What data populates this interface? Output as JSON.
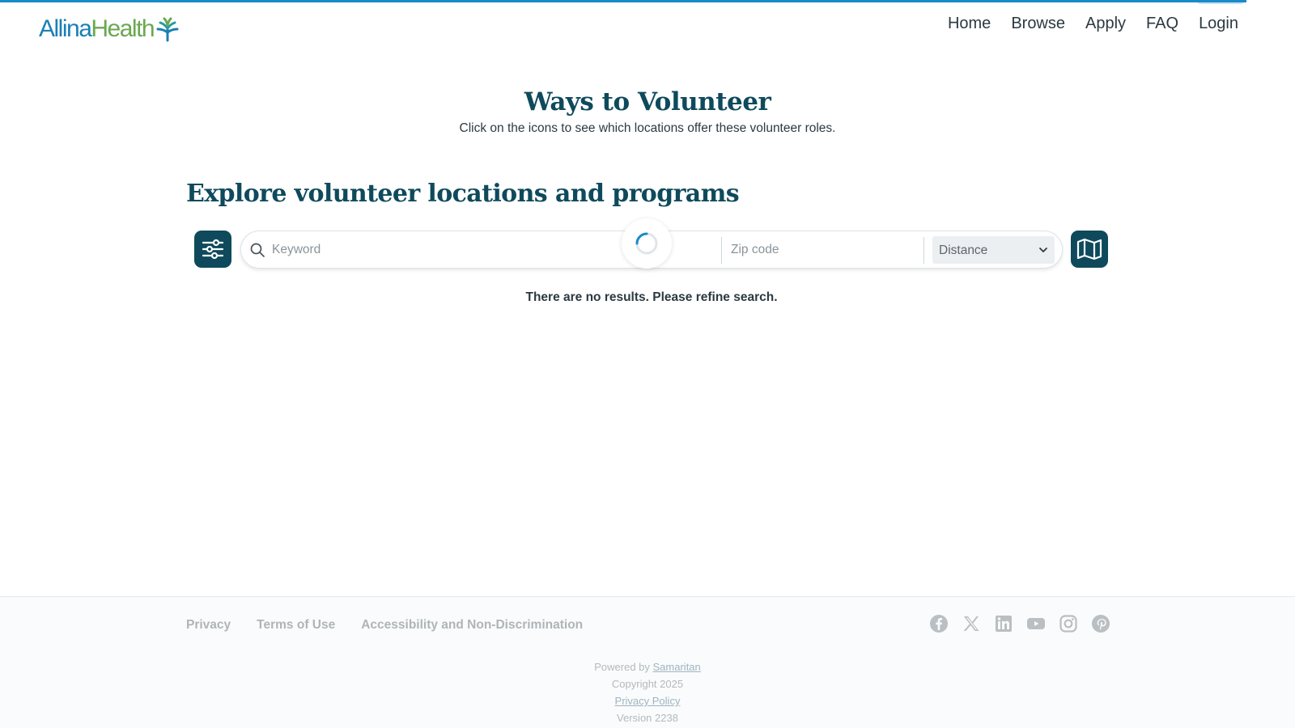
{
  "brand": {
    "name_part1": "Allina",
    "name_part2": "Health",
    "logo_icon": "allina-health-mark-icon",
    "colors": {
      "blue": "#1b7fb5",
      "green": "#6aa84f",
      "teal": "#0e4a5c"
    }
  },
  "nav": {
    "items": [
      {
        "label": "Home"
      },
      {
        "label": "Browse"
      },
      {
        "label": "Apply"
      },
      {
        "label": "FAQ"
      },
      {
        "label": "Login"
      }
    ]
  },
  "hero": {
    "title": "Ways to Volunteer",
    "subtitle": "Click on the icons to see which locations offer these volunteer roles."
  },
  "explore": {
    "title": "Explore volunteer locations and programs",
    "filter_icon": "sliders-icon",
    "map_icon": "map-icon",
    "search_icon": "search-icon",
    "keyword_placeholder": "Keyword",
    "zip_placeholder": "Zip code",
    "distance_selected": "Distance",
    "no_results": "There are no results. Please refine search."
  },
  "footer": {
    "links": [
      {
        "label": "Privacy"
      },
      {
        "label": "Terms of Use"
      },
      {
        "label": "Accessibility and Non-Discrimination"
      }
    ],
    "social_icons": [
      "facebook-icon",
      "x-twitter-icon",
      "linkedin-icon",
      "youtube-icon",
      "instagram-icon",
      "pinterest-icon"
    ],
    "powered_by_prefix": "Powered by",
    "powered_by_link": "Samaritan",
    "copyright": "Copyright 2025",
    "privacy_policy": "Privacy Policy",
    "version": "Version 2238"
  }
}
